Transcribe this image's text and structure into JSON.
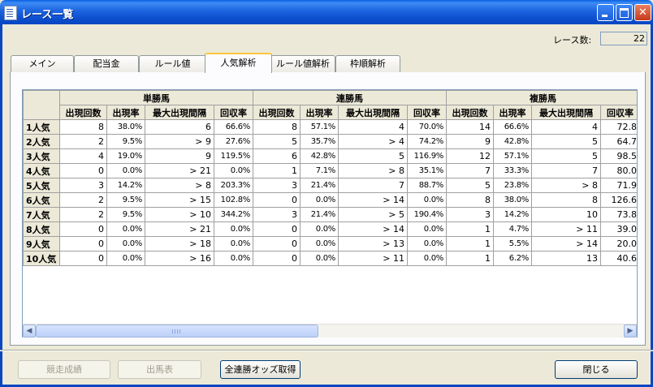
{
  "window": {
    "title": "レース一覧",
    "icon": "document-icon"
  },
  "race_count": {
    "label": "レース数:",
    "value": "22"
  },
  "tabs": [
    {
      "label": "メイン",
      "active": false
    },
    {
      "label": "配当金",
      "active": false
    },
    {
      "label": "ルール値",
      "active": false
    },
    {
      "label": "人気解析",
      "active": true
    },
    {
      "label": "ルール値解析",
      "active": false
    },
    {
      "label": "枠順解析",
      "active": false
    }
  ],
  "grid": {
    "groups": [
      "単勝馬",
      "連勝馬",
      "複勝馬"
    ],
    "columns": [
      "出現回数",
      "出現率",
      "最大出現間隔",
      "回収率"
    ],
    "rows": [
      {
        "label": "1人気",
        "cells": [
          "8",
          "38.0%",
          "6",
          "66.6%",
          "8",
          "57.1%",
          "4",
          "70.0%",
          "14",
          "66.6%",
          "4",
          "72.8"
        ]
      },
      {
        "label": "2人気",
        "cells": [
          "2",
          "9.5%",
          "> 9",
          "27.6%",
          "5",
          "35.7%",
          "> 4",
          "74.2%",
          "9",
          "42.8%",
          "5",
          "64.7"
        ]
      },
      {
        "label": "3人気",
        "cells": [
          "4",
          "19.0%",
          "9",
          "119.5%",
          "6",
          "42.8%",
          "5",
          "116.9%",
          "12",
          "57.1%",
          "5",
          "98.5"
        ]
      },
      {
        "label": "4人気",
        "cells": [
          "0",
          "0.0%",
          "> 21",
          "0.0%",
          "1",
          "7.1%",
          "> 8",
          "35.1%",
          "7",
          "33.3%",
          "7",
          "80.0"
        ]
      },
      {
        "label": "5人気",
        "cells": [
          "3",
          "14.2%",
          "> 8",
          "203.3%",
          "3",
          "21.4%",
          "7",
          "88.7%",
          "5",
          "23.8%",
          "> 8",
          "71.9"
        ]
      },
      {
        "label": "6人気",
        "cells": [
          "2",
          "9.5%",
          "> 15",
          "102.8%",
          "0",
          "0.0%",
          "> 14",
          "0.0%",
          "8",
          "38.0%",
          "8",
          "126.6"
        ]
      },
      {
        "label": "7人気",
        "cells": [
          "2",
          "9.5%",
          "> 10",
          "344.2%",
          "3",
          "21.4%",
          "> 5",
          "190.4%",
          "3",
          "14.2%",
          "10",
          "73.8"
        ]
      },
      {
        "label": "8人気",
        "cells": [
          "0",
          "0.0%",
          "> 21",
          "0.0%",
          "0",
          "0.0%",
          "> 14",
          "0.0%",
          "1",
          "4.7%",
          "> 11",
          "39.0"
        ]
      },
      {
        "label": "9人気",
        "cells": [
          "0",
          "0.0%",
          "> 18",
          "0.0%",
          "0",
          "0.0%",
          "> 13",
          "0.0%",
          "1",
          "5.5%",
          "> 14",
          "20.0"
        ]
      },
      {
        "label": "10人気",
        "cells": [
          "0",
          "0.0%",
          "> 16",
          "0.0%",
          "0",
          "0.0%",
          "> 11",
          "0.0%",
          "1",
          "6.2%",
          "13",
          "40.6"
        ]
      }
    ]
  },
  "buttons": {
    "race_results": {
      "label": "競走成績",
      "enabled": false
    },
    "entry_table": {
      "label": "出馬表",
      "enabled": false
    },
    "fetch_odds": {
      "label": "全連勝オッズ取得",
      "enabled": true
    },
    "close": {
      "label": "閉じる",
      "enabled": true
    }
  },
  "colors": {
    "titlebar": "#0a46c0",
    "window_bg": "#ece9d8",
    "active_tab_accent": "#ffc83c",
    "close_button": "#c6391b"
  }
}
